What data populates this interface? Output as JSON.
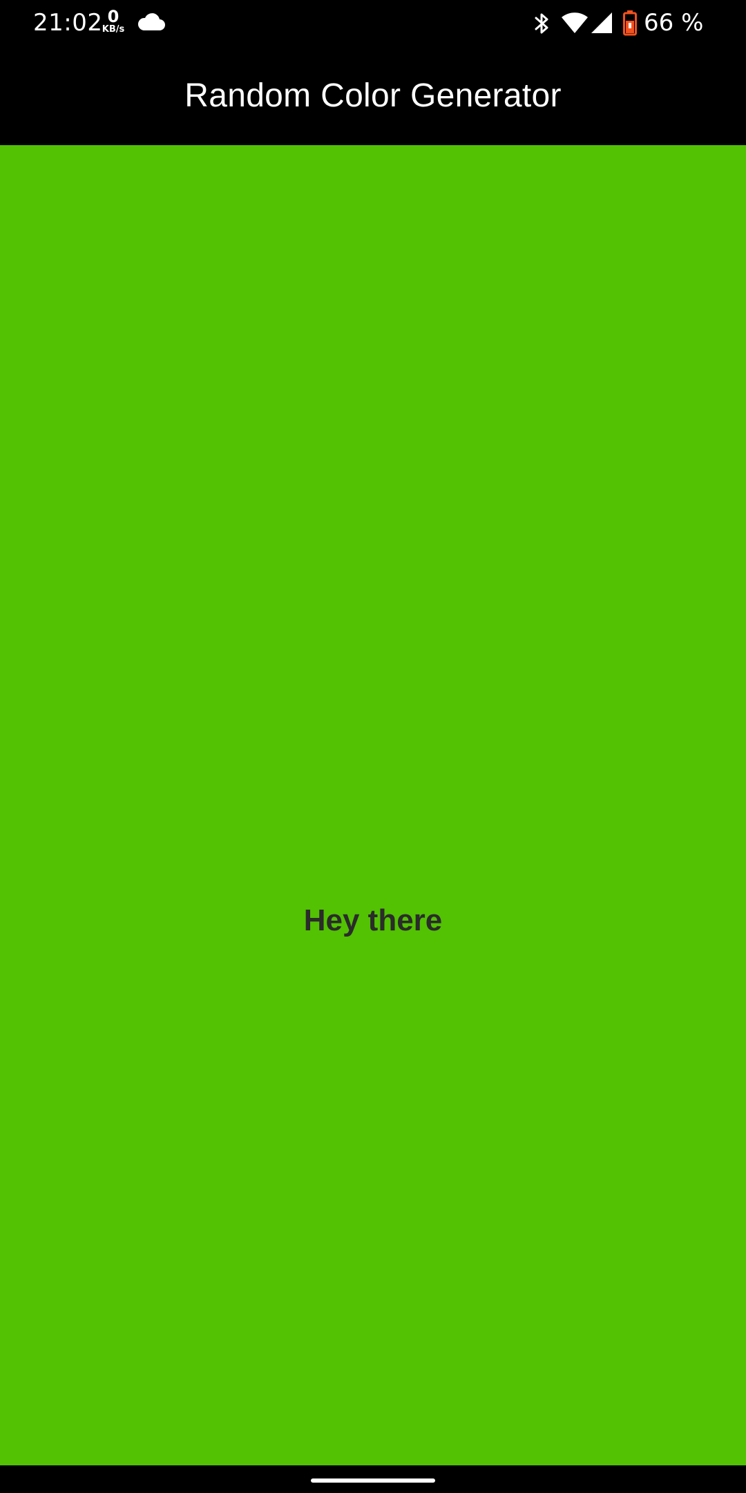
{
  "status_bar": {
    "time": "21:02",
    "net_speed_value": "0",
    "net_speed_unit": "KB/s",
    "battery_percent": "66 %",
    "icons": [
      "cloud-icon",
      "bluetooth-icon",
      "wifi-icon",
      "signal-icon",
      "battery-icon"
    ]
  },
  "app_bar": {
    "title": "Random Color Generator"
  },
  "main": {
    "background_color": "#52c203",
    "text": "Hey there",
    "text_color": "#2b2b2b"
  },
  "colors": {
    "bars": "#000000",
    "battery_accent": "#f4511e"
  }
}
